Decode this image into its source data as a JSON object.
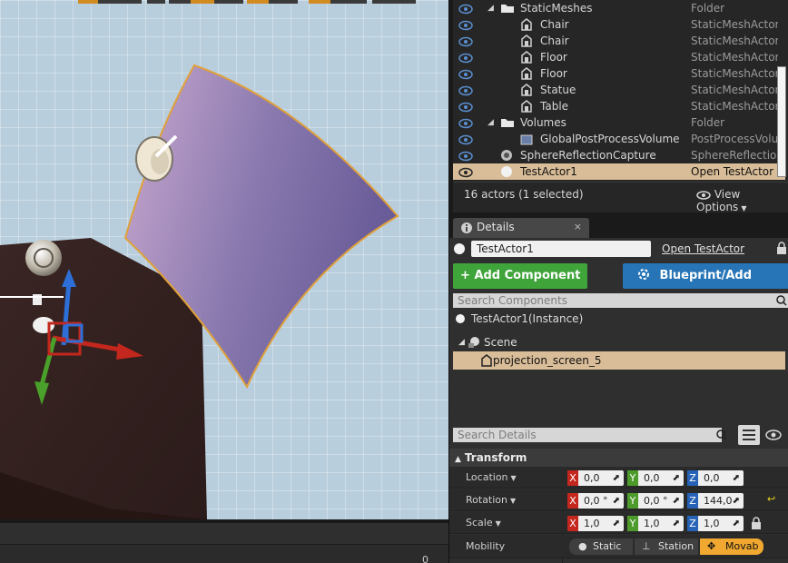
{
  "outliner": {
    "rows": [
      {
        "label": "StaticMeshes",
        "type": "Folder",
        "kind": "folder",
        "indent": 1
      },
      {
        "label": "Chair",
        "type": "StaticMeshActor",
        "kind": "mesh",
        "indent": 2
      },
      {
        "label": "Chair",
        "type": "StaticMeshActor",
        "kind": "mesh",
        "indent": 2
      },
      {
        "label": "Floor",
        "type": "StaticMeshActor",
        "kind": "mesh",
        "indent": 2
      },
      {
        "label": "Floor",
        "type": "StaticMeshActor",
        "kind": "mesh",
        "indent": 2
      },
      {
        "label": "Statue",
        "type": "StaticMeshActor",
        "kind": "mesh",
        "indent": 2
      },
      {
        "label": "Table",
        "type": "StaticMeshActor",
        "kind": "mesh",
        "indent": 2
      },
      {
        "label": "Volumes",
        "type": "Folder",
        "kind": "folder",
        "indent": 1
      },
      {
        "label": "GlobalPostProcessVolume",
        "type": "PostProcessVolum",
        "kind": "volume",
        "indent": 2
      },
      {
        "label": "SphereReflectionCapture",
        "type": "SphereReflectionC",
        "kind": "sphere",
        "indent": 1
      },
      {
        "label": "TestActor1",
        "type": "Open TestActor",
        "kind": "actor",
        "indent": 1,
        "selected": true
      }
    ],
    "footer_count": "16 actors (1 selected)",
    "view_options": "View Options"
  },
  "details": {
    "tab_label": "Details",
    "tab_close": "×",
    "actor_name": "TestActor1",
    "open_link": "Open TestActor",
    "add_component": "Add Component",
    "blueprint_button": "Blueprint/Add Script",
    "search_components_placeholder": "Search Components",
    "instance_label": "TestActor1(Instance)",
    "scene_label": "Scene",
    "component_label": "projection_screen_5",
    "search_details_placeholder": "Search Details",
    "transform_header": "Transform",
    "location_label": "Location",
    "rotation_label": "Rotation",
    "scale_label": "Scale",
    "mobility_label": "Mobility",
    "location": {
      "x": "0,0",
      "y": "0,0",
      "z": "0,0"
    },
    "rotation": {
      "x": "0,0 °",
      "y": "0,0 °",
      "z": "144,0"
    },
    "scale": {
      "x": "1,0",
      "y": "1,0",
      "z": "1,0"
    },
    "axis_x": "X",
    "axis_y": "Y",
    "axis_z": "Z",
    "mobility": {
      "static": "Static",
      "stationary": "Station",
      "movable": "Movab"
    }
  },
  "viewport": {
    "corner_number": "0"
  },
  "colors": {
    "selection": "#d9bd98",
    "add_component": "#3fa43a",
    "blueprint": "#2775b6",
    "movable": "#f0a830"
  },
  "icons": [
    "eye-icon",
    "folder-icon",
    "static-mesh-icon",
    "sphere-icon",
    "actor-icon",
    "gear-icon",
    "magnifier-icon",
    "lock-icon"
  ]
}
